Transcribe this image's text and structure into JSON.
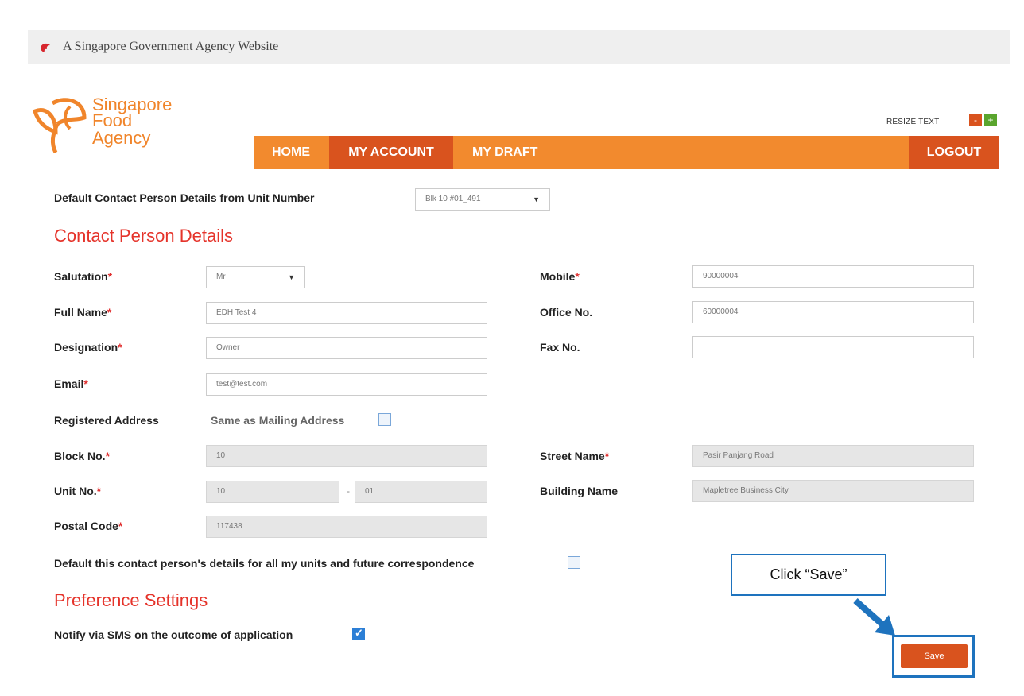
{
  "gov_banner": {
    "text": "A Singapore Government Agency Website"
  },
  "logo": {
    "line1": "Singapore",
    "line2": "Food",
    "line3": "Agency"
  },
  "resize": {
    "label": "RESIZE TEXT",
    "minus": "-",
    "plus": "+"
  },
  "nav": {
    "home": "HOME",
    "my_account": "MY ACCOUNT",
    "my_draft": "MY DRAFT",
    "logout": "LOGOUT"
  },
  "default_contact": {
    "label": "Default Contact Person Details from Unit Number",
    "value": "Blk 10 #01_491"
  },
  "contact_section": {
    "title": "Contact Person Details",
    "salutation": {
      "label": "Salutation",
      "value": "Mr"
    },
    "full_name": {
      "label": "Full Name",
      "value": "EDH Test 4"
    },
    "designation": {
      "label": "Designation",
      "value": "Owner"
    },
    "email": {
      "label": "Email",
      "value": "test@test.com"
    },
    "mobile": {
      "label": "Mobile",
      "value": "90000004"
    },
    "office_no": {
      "label": "Office No.",
      "value": "60000004"
    },
    "fax_no": {
      "label": "Fax No.",
      "value": ""
    },
    "required_mark": "*"
  },
  "address": {
    "registered_label": "Registered Address",
    "same_as_mailing": "Same as Mailing Address",
    "block": {
      "label": "Block No.",
      "value": "10"
    },
    "unit": {
      "label": "Unit No.",
      "value1": "10",
      "value2": "01",
      "separator": "-"
    },
    "postal": {
      "label": "Postal Code",
      "value": "117438"
    },
    "street": {
      "label": "Street Name",
      "value": "Pasir Panjang Road"
    },
    "building": {
      "label": "Building Name",
      "value": "Mapletree Business City"
    }
  },
  "default_all": {
    "label": "Default this contact person's details for all my units and future correspondence"
  },
  "preference": {
    "title": "Preference Settings",
    "notify_sms": "Notify via SMS on the outcome of application"
  },
  "callout": {
    "text": "Click “Save”"
  },
  "save": {
    "label": "Save"
  },
  "colors": {
    "orange": "#f28a2e",
    "dark_orange": "#d9531e",
    "red_heading": "#e5332a",
    "callout_blue": "#1e73be"
  }
}
